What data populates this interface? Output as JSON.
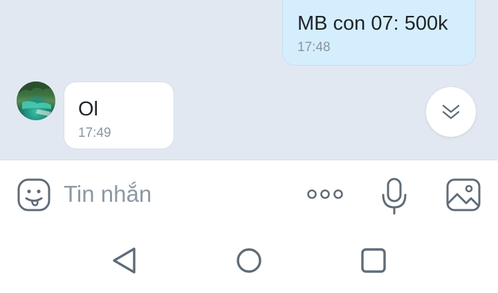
{
  "messages": [
    {
      "direction": "outgoing",
      "text": "MB con 07: 500k",
      "time": "17:48"
    },
    {
      "direction": "incoming",
      "text": "Ol",
      "time": "17:49"
    }
  ],
  "composer": {
    "placeholder": "Tin nhắn",
    "emoji_icon": "sticker-emoji-icon",
    "more_icon": "more-options-icon",
    "mic_icon": "microphone-icon",
    "image_icon": "image-gallery-icon"
  },
  "scroll_down_icon": "double-chevron-down-icon",
  "nav": {
    "back_icon": "back-triangle-icon",
    "home_icon": "home-circle-icon",
    "recent_icon": "recent-apps-square-icon"
  },
  "colors": {
    "chat_background": "#e2e8f1",
    "outgoing_bubble": "#d5eefe",
    "incoming_bubble": "#ffffff",
    "icon_gray": "#5f6b77"
  }
}
